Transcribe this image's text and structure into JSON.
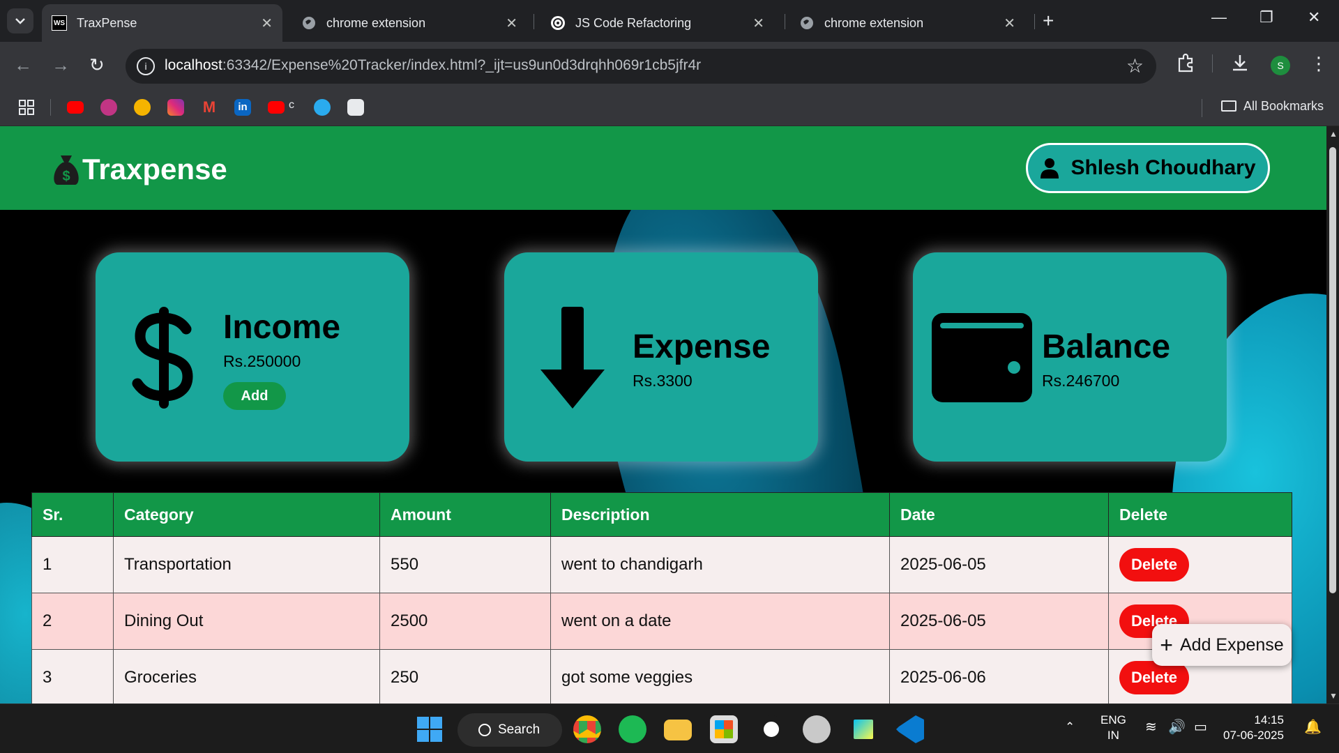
{
  "browser": {
    "tabs": [
      {
        "title": "TraxPense",
        "active": true,
        "icon": "webstorm-icon"
      },
      {
        "title": "chrome extension",
        "active": false,
        "icon": "globe-icon"
      },
      {
        "title": "JS Code Refactoring",
        "active": false,
        "icon": "openai-icon"
      },
      {
        "title": "chrome extension",
        "active": false,
        "icon": "globe-icon"
      }
    ],
    "url_host": "localhost",
    "url_rest": ":63342/Expense%20Tracker/index.html?_ijt=us9un0d3drqhh069r1cb5jfr4r",
    "profile_initial": "S",
    "bookmarks_label": "All Bookmarks",
    "bookmark_c_label": "c"
  },
  "app": {
    "brand": "Traxpense",
    "user_name": "Shlesh Choudhary",
    "colors": {
      "header": "#129748",
      "card": "#1aa79b",
      "delete": "#f20f0f"
    }
  },
  "cards": {
    "income": {
      "title": "Income",
      "value": "Rs.250000",
      "button": "Add",
      "icon": "dollar-icon"
    },
    "expense": {
      "title": "Expense",
      "value": "Rs.3300",
      "icon": "arrow-down-icon"
    },
    "balance": {
      "title": "Balance",
      "value": "Rs.246700",
      "icon": "wallet-icon"
    }
  },
  "table": {
    "headers": [
      "Sr.",
      "Category",
      "Amount",
      "Description",
      "Date",
      "Delete"
    ],
    "rows": [
      {
        "sr": "1",
        "category": "Transportation",
        "amount": "550",
        "description": "went to chandigarh",
        "date": "2025-06-05",
        "action": "Delete"
      },
      {
        "sr": "2",
        "category": "Dining Out",
        "amount": "2500",
        "description": "went on a date",
        "date": "2025-06-05",
        "action": "Delete"
      },
      {
        "sr": "3",
        "category": "Groceries",
        "amount": "250",
        "description": "got some veggies",
        "date": "2025-06-06",
        "action": "Delete"
      }
    ]
  },
  "fab_label": "Add Expense",
  "taskbar": {
    "search_label": "Search",
    "lang_top": "ENG",
    "lang_bottom": "IN",
    "time": "14:15",
    "date": "07-06-2025"
  }
}
